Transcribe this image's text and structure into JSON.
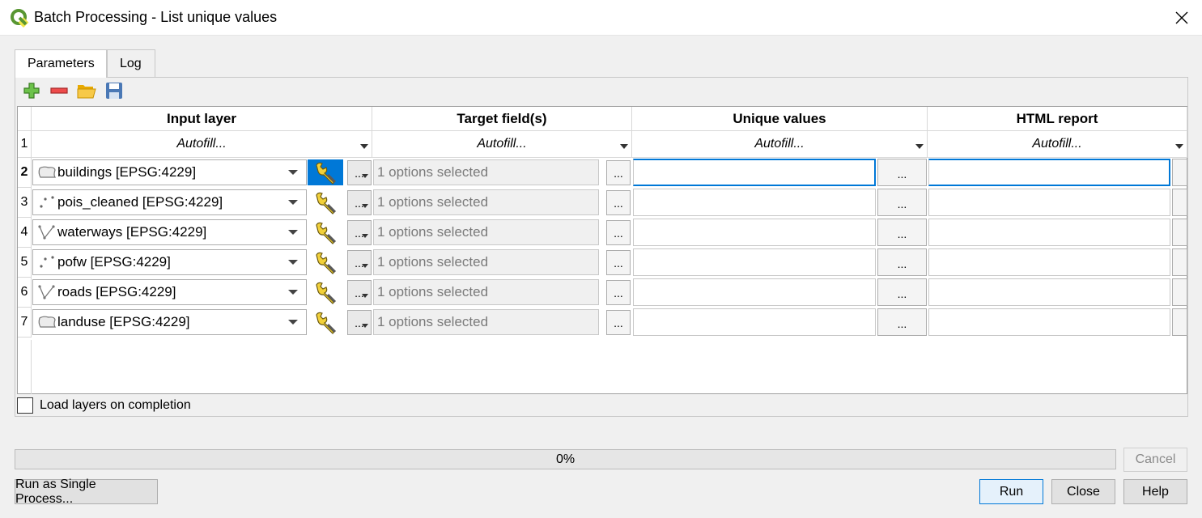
{
  "window": {
    "title": "Batch Processing - List unique values"
  },
  "tabs": [
    {
      "label": "Parameters",
      "active": true
    },
    {
      "label": "Log",
      "active": false
    }
  ],
  "toolbar": {
    "icons": [
      "add-row-icon",
      "remove-row-icon",
      "open-folder-icon",
      "save-icon"
    ]
  },
  "table": {
    "columns": [
      "Input layer",
      "Target field(s)",
      "Unique values",
      "HTML report"
    ],
    "autofill_row": {
      "row_number": "1",
      "label": "Autofill..."
    },
    "rows": [
      {
        "num": "2",
        "layer": "buildings [EPSG:4229]",
        "geometry": "polygon",
        "fields": "1 options selected",
        "selected": true
      },
      {
        "num": "3",
        "layer": "pois_cleaned [EPSG:4229]",
        "geometry": "point",
        "fields": "1 options selected",
        "selected": false
      },
      {
        "num": "4",
        "layer": "waterways [EPSG:4229]",
        "geometry": "line",
        "fields": "1 options selected",
        "selected": false
      },
      {
        "num": "5",
        "layer": "pofw [EPSG:4229]",
        "geometry": "point",
        "fields": "1 options selected",
        "selected": false
      },
      {
        "num": "6",
        "layer": "roads [EPSG:4229]",
        "geometry": "line",
        "fields": "1 options selected",
        "selected": false
      },
      {
        "num": "7",
        "layer": "landuse [EPSG:4229]",
        "geometry": "polygon",
        "fields": "1 options selected",
        "selected": false
      }
    ],
    "dots_label": "..."
  },
  "load_layers": {
    "label": "Load layers on completion",
    "checked": false
  },
  "progress": {
    "value": 0,
    "text": "0%"
  },
  "buttons": {
    "run_single": "Run as Single Process...",
    "cancel": "Cancel",
    "run": "Run",
    "close": "Close",
    "help": "Help"
  },
  "colors": {
    "selection": "#0078d7",
    "progress_fill": "#06b025"
  }
}
